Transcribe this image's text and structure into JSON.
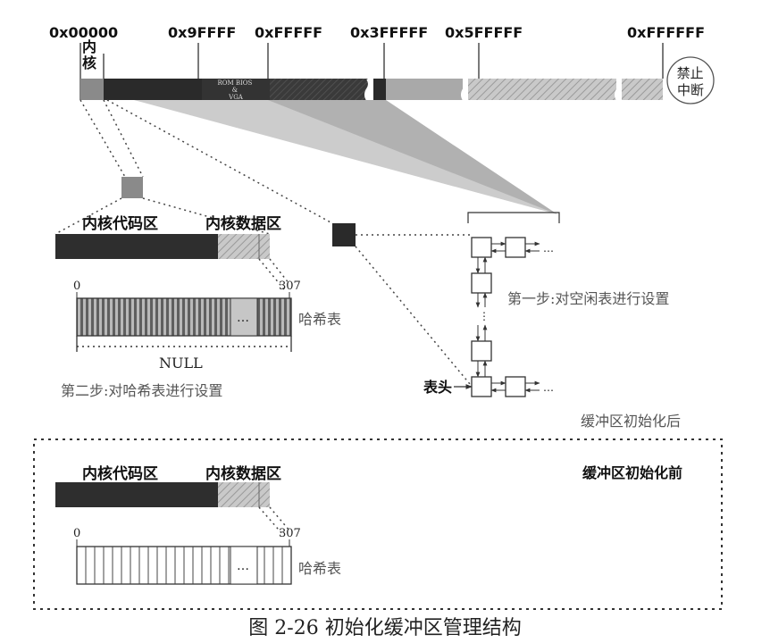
{
  "memory_bar": {
    "addresses": [
      "0x00000",
      "0x9FFFF",
      "0xFFFFF",
      "0x3FFFFF",
      "0x5FFFFF",
      "0xFFFFFF"
    ],
    "kernel_label": "内\n核",
    "rom_label": "ROM BIOS\n&\nVGA",
    "interrupt_label": "禁止\n中断"
  },
  "after_init": {
    "kernel_code_label": "内核代码区",
    "kernel_data_label": "内核数据区",
    "hash_start": "0",
    "hash_end": "307",
    "hash_label": "哈希表",
    "ellipsis": "…",
    "null_label": "NULL",
    "step2_label": "第二步:对哈希表进行设置",
    "step1_label": "第一步:对空闲表进行设置",
    "list_head_label": "表头",
    "after_label": "缓冲区初始化后"
  },
  "before_init": {
    "kernel_code_label": "内核代码区",
    "kernel_data_label": "内核数据区",
    "hash_start": "0",
    "hash_end": "307",
    "hash_label": "哈希表",
    "ellipsis": "…",
    "before_label": "缓冲区初始化前"
  },
  "caption": "图 2-26    初始化缓冲区管理结构",
  "colors": {
    "kernel": "#8a8a8a",
    "dark_block": "#2b2b2b",
    "light_block": "#a9a9a9",
    "hatched_block": "#c4c4c4",
    "line": "#333333"
  }
}
